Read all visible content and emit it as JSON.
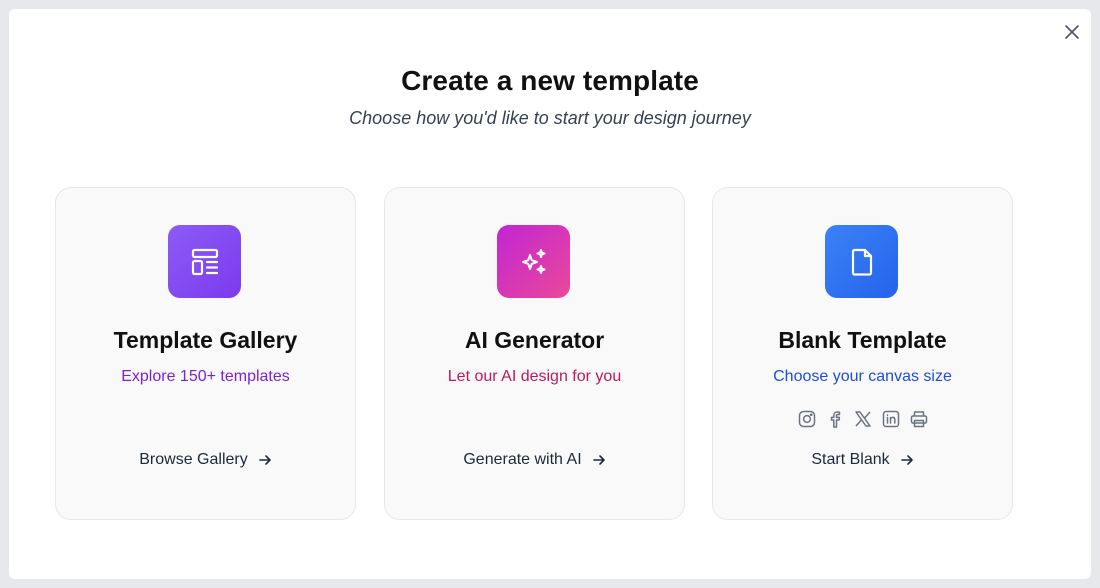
{
  "dialog": {
    "title": "Create a new template",
    "subtitle": "Choose how you'd like to start your design journey",
    "close_icon": "close-icon"
  },
  "cards": [
    {
      "icon": "layout-template-icon",
      "title": "Template Gallery",
      "subtitle": "Explore 150+ templates",
      "action": "Browse Gallery",
      "accent": "#7c3aed"
    },
    {
      "icon": "sparkles-icon",
      "title": "AI Generator",
      "subtitle": "Let our AI design for you",
      "action": "Generate with AI",
      "accent": "#db2777"
    },
    {
      "icon": "file-icon",
      "title": "Blank Template",
      "subtitle": "Choose your canvas size",
      "action": "Start Blank",
      "accent": "#2563eb",
      "social_icons": [
        "instagram-icon",
        "facebook-icon",
        "x-icon",
        "linkedin-icon",
        "printer-icon"
      ]
    }
  ],
  "colors": {
    "backdrop": "#e6e8ec",
    "card_bg": "#f9f9fa",
    "card_border": "#e5e7eb"
  }
}
